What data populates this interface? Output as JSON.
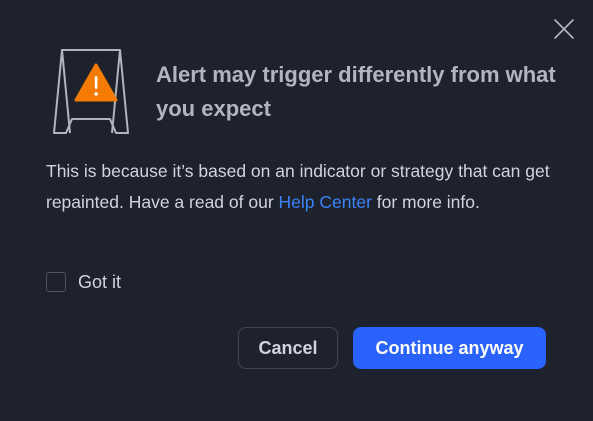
{
  "dialog": {
    "title": "Alert may trigger differently from what you expect",
    "body_before_link": "This is because it’s based on an indicator or strategy that can get repainted. Have a read of our ",
    "link_text": "Help Center",
    "body_after_link": " for more info.",
    "checkbox_label": "Got it",
    "checkbox_checked": false,
    "cancel_label": "Cancel",
    "continue_label": "Continue anyway"
  },
  "icons": {
    "close": "close-icon",
    "illustration": "warning-sign-icon"
  },
  "colors": {
    "background": "#1e222d",
    "title": "#b2b5be",
    "text": "#d1d4dc",
    "link": "#3b82f6",
    "primary": "#2962ff",
    "warning": "#f57c00",
    "border": "#434651"
  }
}
